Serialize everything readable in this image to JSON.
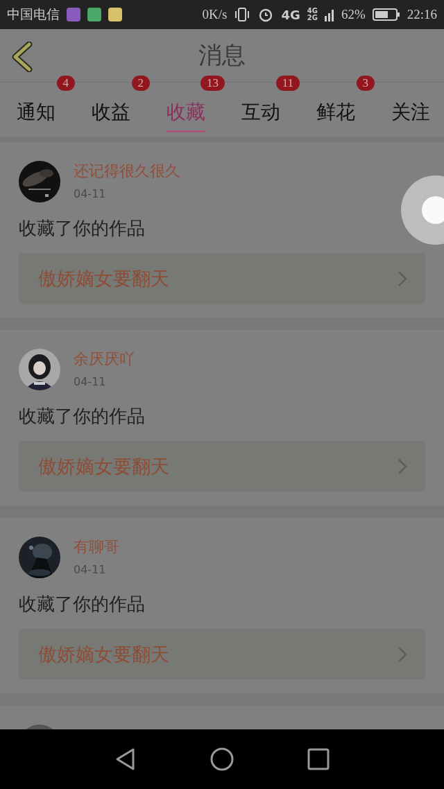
{
  "status_bar": {
    "carrier": "中国电信",
    "speed": "0K/s",
    "network": "4G",
    "network_small_top": "4G",
    "network_small_bottom": "2G",
    "battery": "62%",
    "time": "22:16"
  },
  "header": {
    "title": "消息"
  },
  "tabs": [
    {
      "label": "通知",
      "badge": "4",
      "selected": false
    },
    {
      "label": "收益",
      "badge": "2",
      "selected": false
    },
    {
      "label": "收藏",
      "badge": "13",
      "selected": true
    },
    {
      "label": "互动",
      "badge": "11",
      "selected": false
    },
    {
      "label": "鲜花",
      "badge": "3",
      "selected": false
    },
    {
      "label": "关注",
      "selected": false
    }
  ],
  "items": [
    {
      "name": "还记得很久很久",
      "date": "04-11",
      "action": "收藏了你的作品",
      "work": "傲娇嫡女要翻天"
    },
    {
      "name": "余厌厌吖",
      "date": "04-11",
      "action": "收藏了你的作品",
      "work": "傲娇嫡女要翻天"
    },
    {
      "name": "有聊哥",
      "date": "04-11",
      "action": "收藏了你的作品",
      "work": "傲娇嫡女要翻天"
    }
  ]
}
